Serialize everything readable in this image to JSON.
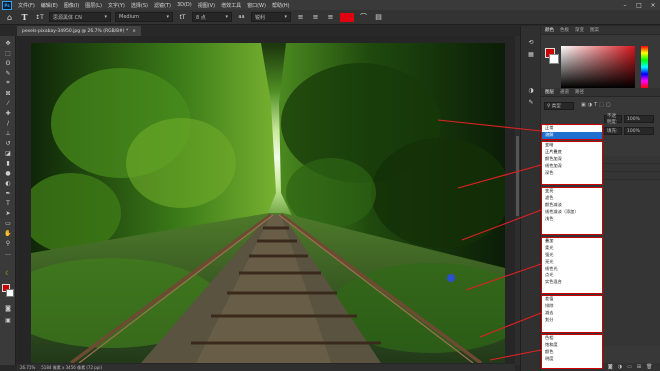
{
  "menu": {
    "logo": "Ps",
    "items": [
      "文件(F)",
      "编辑(E)",
      "图像(I)",
      "图层(L)",
      "文字(Y)",
      "选择(S)",
      "滤镜(T)",
      "3D(D)",
      "视图(V)",
      "增效工具",
      "窗口(W)",
      "帮助(H)"
    ]
  },
  "options": {
    "font_family": "思源黑体 CN",
    "font_style": "Medium",
    "font_size": "8 点",
    "antialias": "锐利",
    "text_color": "#e00010"
  },
  "document": {
    "tab_title": "pexels-pixabay-34950.jpg @ 26.7% (RGB/8#) *",
    "status_zoom": "26.71%",
    "status_size": "5184 像素 x 3456 像素 (72 ppi)"
  },
  "panels": {
    "top_tabs": [
      "颜色",
      "色板",
      "渐变",
      "图案"
    ],
    "mid_tabs": [
      "图层",
      "通道",
      "路径"
    ],
    "kind_label": "类型",
    "opacity_label": "不透明度:",
    "fill_label": "填充:",
    "lock_label": "锁定:"
  },
  "blend_groups": [
    {
      "items": [
        "正常",
        "溶解"
      ],
      "selected_index": 1
    },
    {
      "items": [
        "变暗",
        "正片叠底",
        "颜色加深",
        "线性加深",
        "深色"
      ]
    },
    {
      "items": [
        "变亮",
        "滤色",
        "颜色减淡",
        "线性减淡（添加）",
        "浅色"
      ]
    },
    {
      "items": [
        "叠加",
        "柔光",
        "强光",
        "亮光",
        "线性光",
        "点光",
        "实色混合"
      ]
    },
    {
      "items": [
        "差值",
        "排除",
        "减去",
        "划分"
      ]
    },
    {
      "items": [
        "色相",
        "饱和度",
        "颜色",
        "明度"
      ]
    }
  ],
  "colors": {
    "accent_red": "#d01818",
    "selection_blue": "#1f6fd1"
  }
}
